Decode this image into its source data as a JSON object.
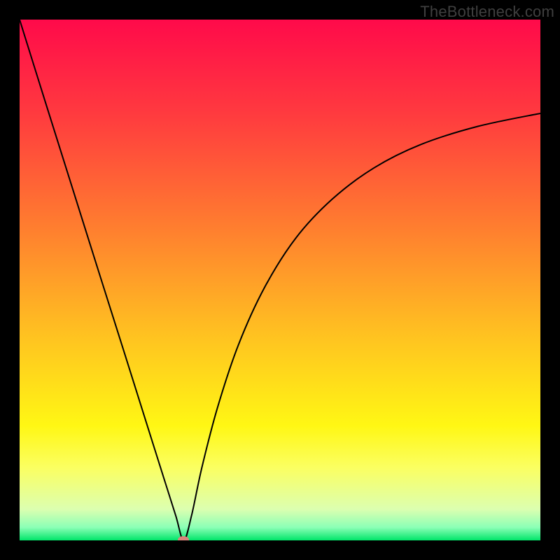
{
  "watermark": "TheBottleneck.com",
  "chart_data": {
    "type": "line",
    "title": "",
    "xlabel": "",
    "ylabel": "",
    "xlim": [
      0,
      100
    ],
    "ylim": [
      0,
      100
    ],
    "grid": false,
    "gradient_stops": [
      {
        "offset": 0,
        "color": "#ff0a4a"
      },
      {
        "offset": 0.18,
        "color": "#ff3a3f"
      },
      {
        "offset": 0.4,
        "color": "#ff7e2f"
      },
      {
        "offset": 0.6,
        "color": "#ffc021"
      },
      {
        "offset": 0.78,
        "color": "#fff714"
      },
      {
        "offset": 0.86,
        "color": "#fbff61"
      },
      {
        "offset": 0.94,
        "color": "#dcffb0"
      },
      {
        "offset": 0.975,
        "color": "#8bffb6"
      },
      {
        "offset": 1.0,
        "color": "#00e56a"
      }
    ],
    "series": [
      {
        "name": "bottleneck-curve",
        "x": [
          0.0,
          5.0,
          10.0,
          15.0,
          20.0,
          25.0,
          28.0,
          30.0,
          31.5,
          33.0,
          35.0,
          38.0,
          42.0,
          47.0,
          53.0,
          60.0,
          68.0,
          77.0,
          88.0,
          100.0
        ],
        "y": [
          100.0,
          84.0,
          68.1,
          52.2,
          36.4,
          20.5,
          11.0,
          4.7,
          0.0,
          4.7,
          14.0,
          25.5,
          37.5,
          48.5,
          58.0,
          65.5,
          71.5,
          76.0,
          79.5,
          82.0
        ]
      }
    ],
    "marker": {
      "x": 31.5,
      "y": 0.0,
      "color": "#d9847b"
    },
    "annotations": []
  }
}
